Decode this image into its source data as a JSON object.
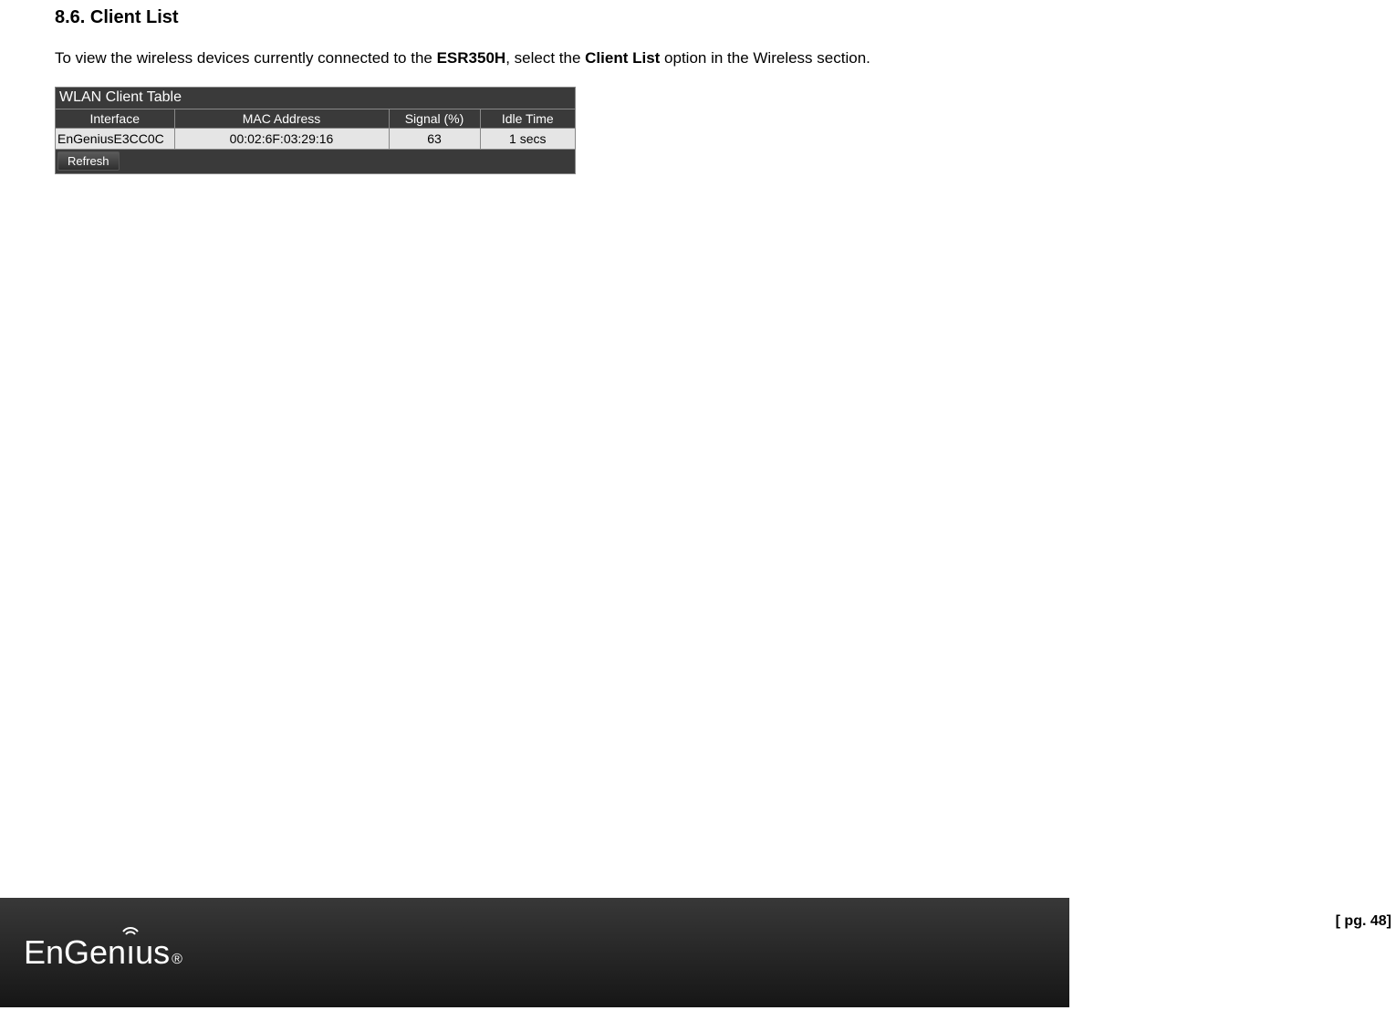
{
  "section": {
    "number": "8.6.",
    "title": "Client List"
  },
  "intro": {
    "pre": "To view the wireless devices currently connected to the ",
    "model": "ESR350H",
    "mid": ", select the ",
    "option": "Client List",
    "post": " option in the Wireless section."
  },
  "wlan": {
    "title": "WLAN Client Table",
    "headers": {
      "interface": "Interface",
      "mac": "MAC Address",
      "signal": "Signal (%)",
      "idle": "Idle Time"
    },
    "row": {
      "interface": "EnGeniusE3CC0C",
      "mac": "00:02:6F:03:29:16",
      "signal": "63",
      "idle": "1 secs"
    },
    "refresh": "Refresh"
  },
  "footer": {
    "brand_part1": "EnGen",
    "brand_part2": "ı",
    "brand_part3": "us",
    "reg": "®"
  },
  "page_number": "[ pg. 48]"
}
